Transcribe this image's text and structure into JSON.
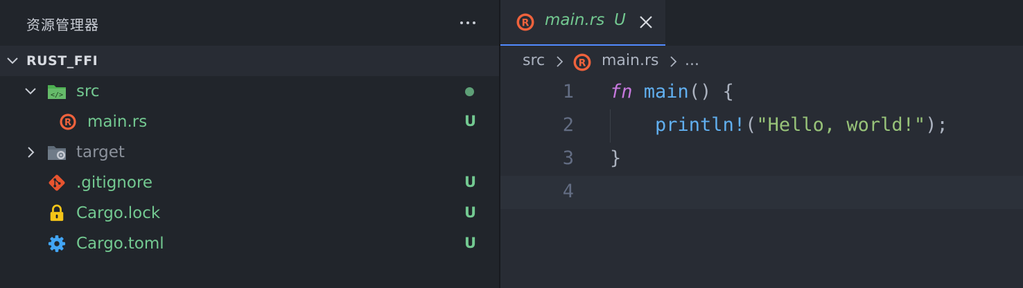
{
  "explorer": {
    "title": "资源管理器",
    "more_icon": "ellipsis-icon",
    "section": {
      "title": "RUST_FFI",
      "expanded": true
    },
    "items": [
      {
        "label": "src",
        "type": "folder",
        "expanded": true,
        "status": "dot",
        "icon": "folder-src-icon",
        "color": "#73c991"
      },
      {
        "label": "main.rs",
        "type": "file",
        "status": "U",
        "icon": "rust-icon",
        "color": "#73c991"
      },
      {
        "label": "target",
        "type": "folder",
        "expanded": false,
        "status": "",
        "icon": "folder-target-icon",
        "color": "#8b919b"
      },
      {
        "label": ".gitignore",
        "type": "file",
        "status": "U",
        "icon": "git-icon",
        "color": "#73c991"
      },
      {
        "label": "Cargo.lock",
        "type": "file",
        "status": "U",
        "icon": "lock-icon",
        "color": "#73c991"
      },
      {
        "label": "Cargo.toml",
        "type": "file",
        "status": "U",
        "icon": "gear-icon",
        "color": "#73c991"
      }
    ]
  },
  "editor": {
    "tab": {
      "label": "main.rs",
      "badge": "U",
      "icon": "rust-icon"
    },
    "breadcrumb": {
      "folder": "src",
      "file": "main.rs",
      "more": "..."
    },
    "lines": [
      {
        "number": "1",
        "tokens": [
          {
            "t": "fn",
            "c": "kw"
          },
          {
            "t": " ",
            "c": "pn"
          },
          {
            "t": "main",
            "c": "fn"
          },
          {
            "t": "() {",
            "c": "pn"
          }
        ]
      },
      {
        "number": "2",
        "tokens": [
          {
            "t": "    ",
            "c": "pn"
          },
          {
            "t": "println!",
            "c": "fn"
          },
          {
            "t": "(",
            "c": "pn"
          },
          {
            "t": "\"Hello, world!\"",
            "c": "str"
          },
          {
            "t": ");",
            "c": "pn"
          }
        ]
      },
      {
        "number": "3",
        "tokens": [
          {
            "t": "}",
            "c": "pn"
          }
        ]
      },
      {
        "number": "4",
        "tokens": []
      }
    ],
    "current_line": 4
  },
  "colors": {
    "accent": "#528bff",
    "untracked": "#73c991",
    "rust": "#f0623c"
  }
}
